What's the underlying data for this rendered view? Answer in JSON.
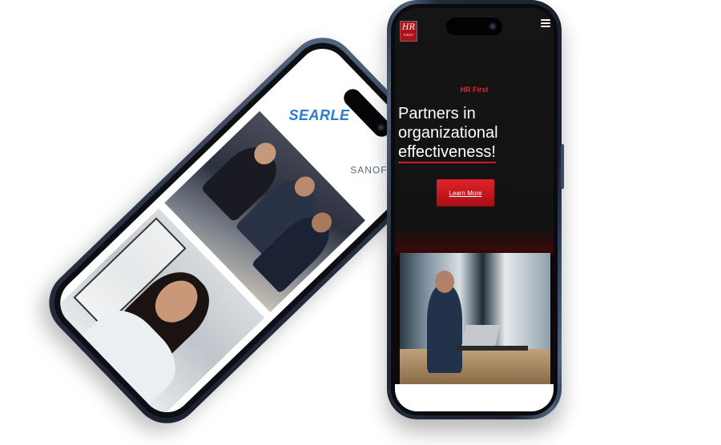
{
  "left_phone": {
    "logos": {
      "searle": "SEARLE",
      "sanofi": "SANOFI"
    }
  },
  "right_phone": {
    "brand": {
      "hr": "HR",
      "first": "FIRST"
    },
    "kicker": "HR First",
    "headline": {
      "line1": "Partners in",
      "line2": "organizational",
      "line3": "effectiveness!"
    },
    "cta_label": "Learn More"
  },
  "colors": {
    "accent_red": "#d11a22",
    "dark_bg": "#121212",
    "searle_blue": "#2b7bd0"
  }
}
